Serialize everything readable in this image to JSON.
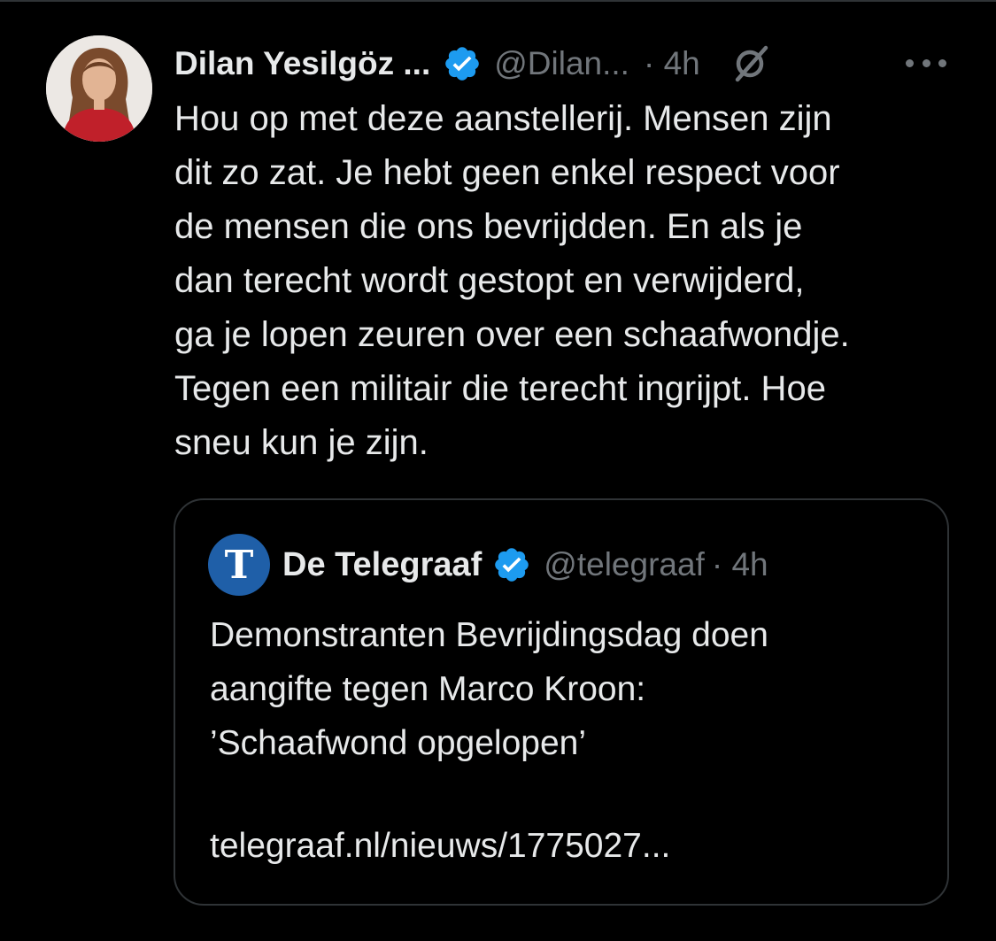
{
  "colors": {
    "background": "#000000",
    "text_primary": "#e7e9ea",
    "text_secondary": "#71767b",
    "verified_blue": "#1d9bf0",
    "border": "#2f3336",
    "telegraaf_blue": "#1f5fa8"
  },
  "tweet": {
    "author_name": "Dilan Yesilgöz ...",
    "handle": "@Dilan...",
    "time": "· 4h",
    "verified_icon": "verified-badge-icon",
    "grok_icon": "grok-icon",
    "more_icon": "more-options-icon",
    "text": "Hou op met deze aanstellerij. Mensen zijn\ndit zo zat. Je hebt geen enkel respect voor\nde mensen die ons bevrijdden. En als je\ndan terecht wordt gestopt en verwijderd,\nga je lopen zeuren over een schaafwondje.\nTegen een militair die terecht ingrijpt. Hoe\nsneu kun je zijn."
  },
  "quote": {
    "logo_glyph": "T",
    "name": "De Telegraaf",
    "handle": "@telegraaf",
    "time": "· 4h",
    "text": "Demonstranten Bevrijdingsdag doen\naangifte tegen Marco Kroon:\n’Schaafwond opgelopen’",
    "link": "telegraaf.nl/nieuws/1775027..."
  }
}
